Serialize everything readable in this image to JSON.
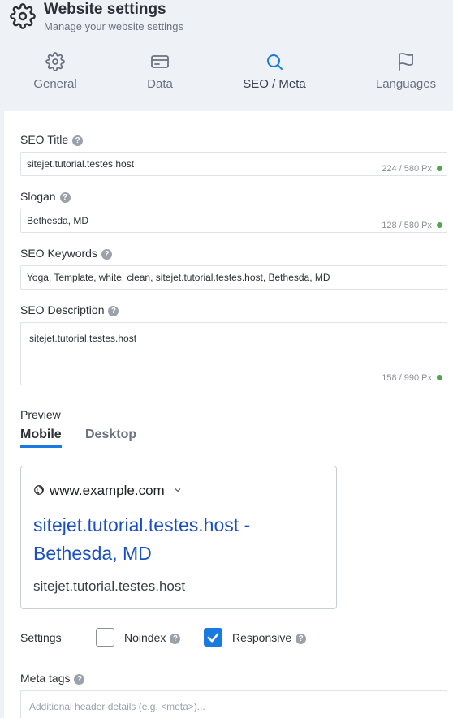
{
  "header": {
    "icon": "gear-icon",
    "title": "Website settings",
    "subtitle": "Manage your website settings"
  },
  "tabs": [
    {
      "label": "General",
      "icon": "gear-icon"
    },
    {
      "label": "Data",
      "icon": "card-icon"
    },
    {
      "label": "SEO / Meta",
      "icon": "search-icon",
      "active": true
    },
    {
      "label": "Languages",
      "icon": "flag-icon"
    }
  ],
  "seo": {
    "title_label": "SEO Title",
    "title_value": "sitejet.tutorial.testes.host",
    "title_counter": "224 / 580 Px",
    "slogan_label": "Slogan",
    "slogan_value": "Bethesda, MD",
    "slogan_counter": "128 / 580 Px",
    "keywords_label": "SEO Keywords",
    "keywords_value": "Yoga, Template, white, clean, sitejet.tutorial.testes.host, Bethesda, MD",
    "description_label": "SEO Description",
    "description_value": "sitejet.tutorial.testes.host",
    "description_counter": "158 / 990 Px"
  },
  "preview": {
    "label": "Preview",
    "tabs": [
      "Mobile",
      "Desktop"
    ],
    "active_tab": "Mobile",
    "url": "www.example.com",
    "title": "sitejet.tutorial.testes.host - Bethesda, MD",
    "description": "sitejet.tutorial.testes.host"
  },
  "settings": {
    "label": "Settings",
    "noindex_label": "Noindex",
    "noindex_checked": false,
    "responsive_label": "Responsive",
    "responsive_checked": true
  },
  "meta_tags": {
    "label": "Meta tags",
    "placeholder": "Additional header details (e.g. <meta>)..."
  },
  "colors": {
    "accent": "#1b7ae0",
    "status_ok": "#53a553",
    "link": "#1a4fc4",
    "header_bg": "#eef1f6"
  }
}
